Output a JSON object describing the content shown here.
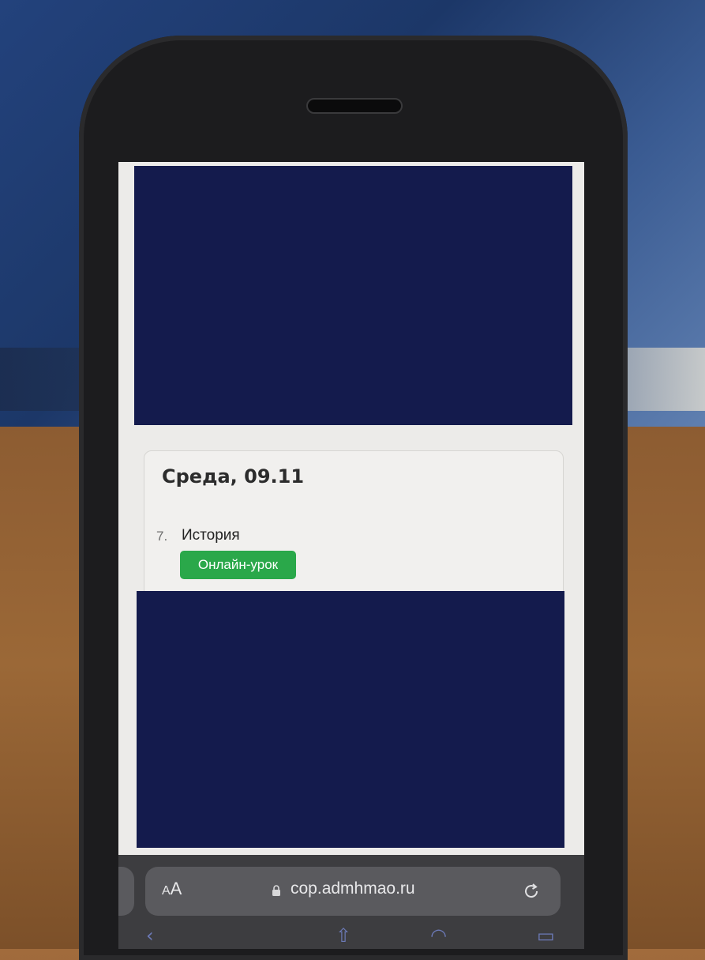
{
  "schedule": {
    "day_title": "Среда, 09.11",
    "lessons": [
      {
        "number": "7.",
        "name": "История",
        "badge": "Онлайн-урок"
      }
    ]
  },
  "browser": {
    "text_size_label_small": "A",
    "text_size_label_large": "A",
    "url": "cop.admhmao.ru",
    "icons": {
      "lock": "lock-icon",
      "reload": "reload-icon",
      "back": "back-arrow-icon",
      "share": "share-icon",
      "bookmarks": "bookmarks-icon",
      "tabs": "tabs-icon"
    }
  },
  "colors": {
    "badge": "#2aa84a",
    "redaction": "#141b4d",
    "page_background": "#ecebe9"
  }
}
